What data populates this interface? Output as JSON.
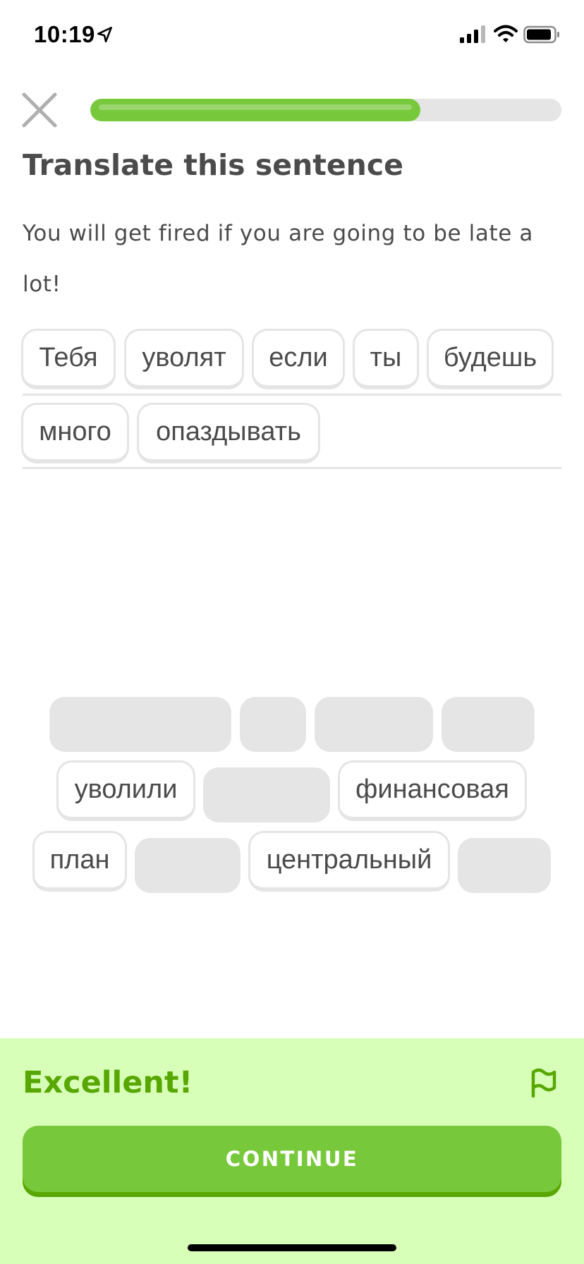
{
  "status_bar": {
    "time": "10:19",
    "icons": [
      "location-arrow-icon",
      "cellular-signal-icon",
      "wifi-icon",
      "battery-icon"
    ]
  },
  "header": {
    "close_icon": "close-icon",
    "progress_fraction": 0.7
  },
  "prompt": {
    "title": "Translate this sentence",
    "sentence": "You will get fired if you are going to be late a lot!"
  },
  "answer": {
    "row1": [
      "Тебя",
      "уволят",
      "если",
      "ты",
      "будешь"
    ],
    "row2": [
      "много",
      "опаздывать"
    ]
  },
  "word_bank": {
    "row1": [
      {
        "text": "",
        "used": true
      },
      {
        "text": "",
        "used": true
      },
      {
        "text": "",
        "used": true
      },
      {
        "text": "",
        "used": true
      }
    ],
    "row2": [
      {
        "text": "уволили",
        "used": false
      },
      {
        "text": "",
        "used": true
      },
      {
        "text": "финансовая",
        "used": false
      }
    ],
    "row3": [
      {
        "text": "план",
        "used": false
      },
      {
        "text": "",
        "used": true
      },
      {
        "text": "центральный",
        "used": false
      },
      {
        "text": "",
        "used": true
      }
    ]
  },
  "feedback": {
    "title": "Excellent!",
    "flag_icon": "report-flag-icon",
    "continue_label": "CONTINUE"
  },
  "colors": {
    "accent_green": "#78c83c",
    "accent_green_dark": "#58a700",
    "feedback_bg": "#d7ffb8",
    "tile_border": "#e5e5e5",
    "text": "#4b4b4b"
  }
}
